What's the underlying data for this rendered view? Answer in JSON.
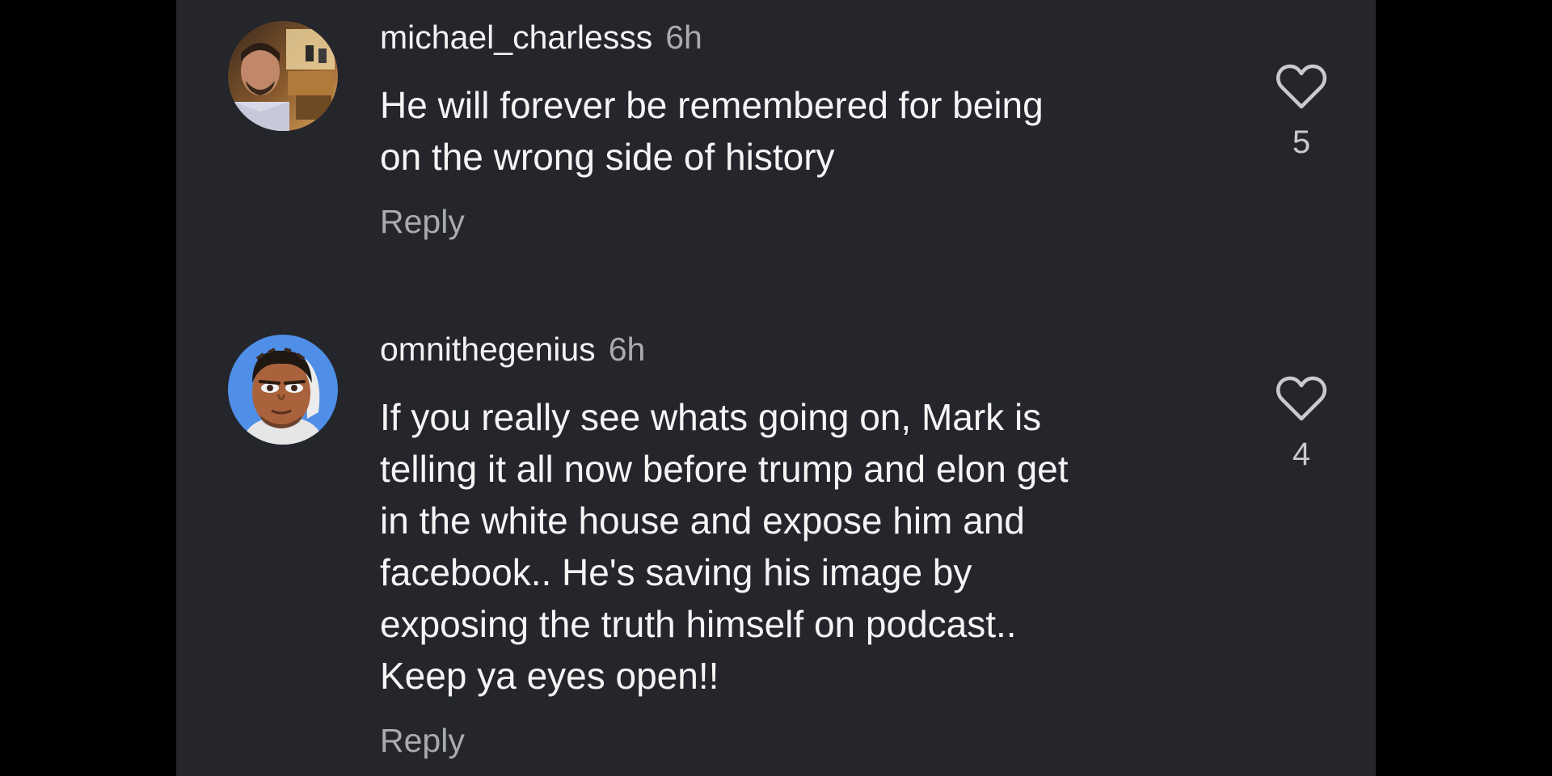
{
  "comments": [
    {
      "username": "michael_charlesss",
      "time": "6h",
      "text": "He will forever be remembered for being\non the wrong side of history",
      "reply_label": "Reply",
      "likes": "5"
    },
    {
      "username": "omnithegenius",
      "time": "6h",
      "text": "If you really see whats going on, Mark is\ntelling it all now before trump and elon get\nin the white house and expose him and\nfacebook.. He's saving his image by\nexposing the truth himself on podcast..\nKeep ya eyes open!!",
      "reply_label": "Reply",
      "likes": "4"
    }
  ],
  "icons": {
    "like": "heart-outline-icon",
    "avatar_1": "photo-avatar",
    "avatar_2": "cartoon-avatar"
  },
  "colors": {
    "background": "#24262b",
    "letterbox": "#000000",
    "text_primary": "#f5f5f5",
    "text_secondary": "#a9abaf"
  }
}
